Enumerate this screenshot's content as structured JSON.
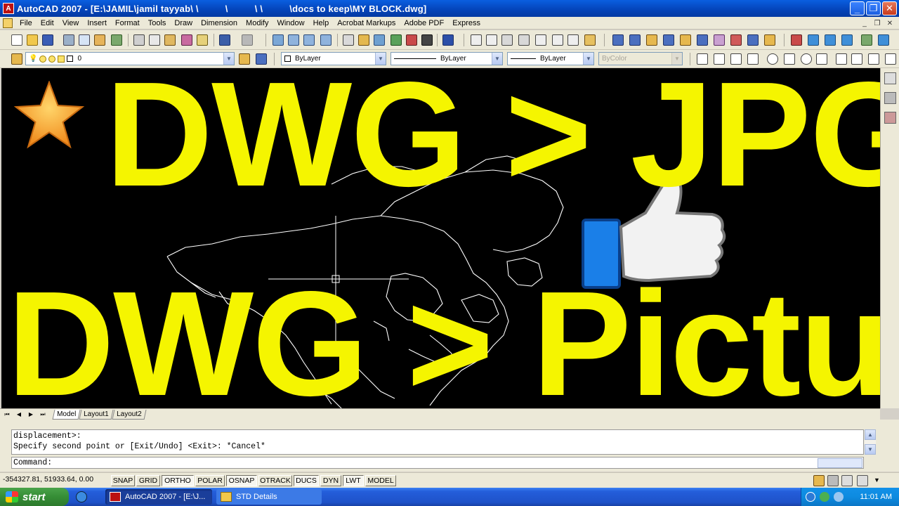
{
  "window": {
    "title": "AutoCAD 2007 - [E:\\JAMIL\\jamil tayyab\\ \\          \\          \\ \\          \\docs to keep\\MY BLOCK.dwg]",
    "app_icon_label": "A",
    "minimize": "_",
    "maximize": "❐",
    "close": "✕"
  },
  "menu": {
    "items": [
      "File",
      "Edit",
      "View",
      "Insert",
      "Format",
      "Tools",
      "Draw",
      "Dimension",
      "Modify",
      "Window",
      "Help",
      "Acrobat Markups",
      "Adobe PDF",
      "Express"
    ],
    "mdi_min": "_",
    "mdi_restore": "❐",
    "mdi_close": "✕"
  },
  "layers_toolbar": {
    "layer_value": "0",
    "color_value": "ByLayer",
    "linetype_value": "ByLayer",
    "lineweight_value": "ByLayer",
    "plotstyle_value": "ByColor"
  },
  "overlay": {
    "line1": "DWG > JPG",
    "line2": "DWG > Picture",
    "star_icon": "star",
    "thumb_icon": "thumbs-up"
  },
  "tabs": {
    "nav": [
      "⏮",
      "◀",
      "▶",
      "⏭"
    ],
    "items": [
      "Model",
      "Layout1",
      "Layout2"
    ],
    "active": "Model"
  },
  "command": {
    "history": [
      "displacement>:",
      "Specify second point or [Exit/Undo] <Exit>: *Cancel*"
    ],
    "prompt": "Command:",
    "scroll_up": "▲",
    "scroll_down": "▼"
  },
  "status": {
    "coords": "-354327.81, 51933.64, 0.00",
    "toggles": [
      {
        "label": "SNAP",
        "on": false
      },
      {
        "label": "GRID",
        "on": false
      },
      {
        "label": "ORTHO",
        "on": true
      },
      {
        "label": "POLAR",
        "on": false
      },
      {
        "label": "OSNAP",
        "on": true
      },
      {
        "label": "OTRACK",
        "on": false
      },
      {
        "label": "DUCS",
        "on": true
      },
      {
        "label": "DYN",
        "on": false
      },
      {
        "label": "LWT",
        "on": true
      },
      {
        "label": "MODEL",
        "on": false
      }
    ]
  },
  "taskbar": {
    "start": "start",
    "tasks": [
      {
        "label": "AutoCAD 2007 - [E:\\J...",
        "active": true
      },
      {
        "label": "STD Details",
        "active": false
      }
    ],
    "clock": "11:01 AM"
  },
  "colors": {
    "overlay_text": "#f5f500",
    "drawing_bg": "#000000",
    "titlebar": "#0443b8",
    "chrome": "#ece9d8"
  }
}
